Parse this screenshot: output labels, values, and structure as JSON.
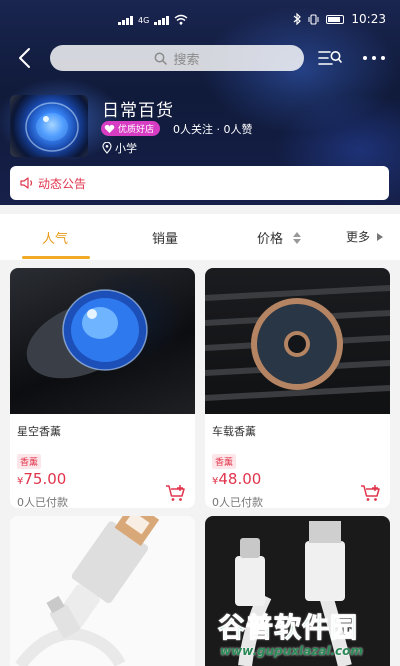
{
  "status_bar": {
    "time": "10:23",
    "network": "4G"
  },
  "nav": {
    "search_placeholder": "搜索"
  },
  "shop": {
    "name": "日常百货",
    "badge": "优质好店",
    "stats": "0人关注 · 0人赞",
    "location": "小学",
    "announcement": "动态公告"
  },
  "tabs": [
    {
      "label": "人气",
      "active": true
    },
    {
      "label": "销量",
      "active": false
    },
    {
      "label": "价格",
      "active": false
    },
    {
      "label": "更多",
      "active": false
    }
  ],
  "products": [
    {
      "title": "星空香薰",
      "tag": "香薰",
      "currency": "¥",
      "price": "75.00",
      "sold": "0人已付款",
      "icon": "cart-plus-icon"
    },
    {
      "title": "车载香薰",
      "tag": "香薰",
      "currency": "¥",
      "price": "48.00",
      "sold": "0人已付款",
      "icon": "cart-plus-icon"
    }
  ],
  "watermark": {
    "brand": "谷普软件园",
    "url": "www.gupuxlazal.com"
  },
  "colors": {
    "accent": "#e0354c",
    "tab_active": "#e89a1a",
    "badge": "#d63dc2"
  }
}
